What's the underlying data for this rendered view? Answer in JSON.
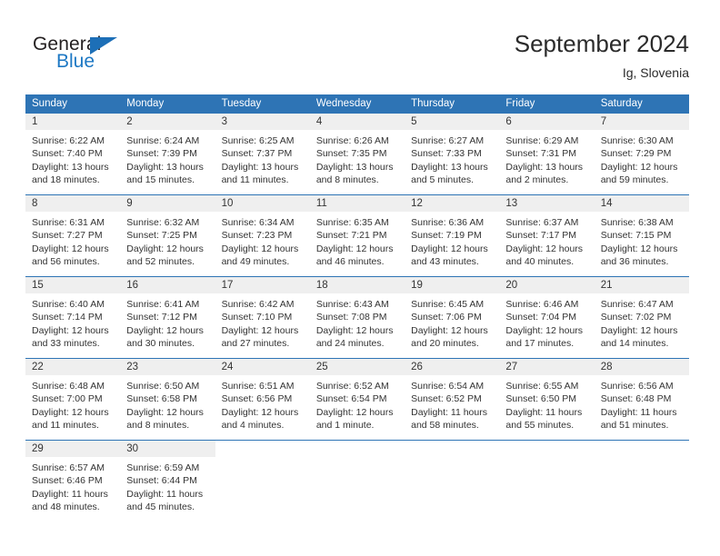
{
  "brand": {
    "name_dark": "General",
    "name_blue": "Blue",
    "triangle_color": "#1d6fb7"
  },
  "header": {
    "title": "September 2024",
    "subtitle": "Ig, Slovenia"
  },
  "theme": {
    "header_blue": "#2e74b5",
    "day_strip_gray": "#efefef",
    "text_color": "#333333"
  },
  "weekdays": [
    "Sunday",
    "Monday",
    "Tuesday",
    "Wednesday",
    "Thursday",
    "Friday",
    "Saturday"
  ],
  "weeks": [
    [
      {
        "day": "1",
        "sunrise": "Sunrise: 6:22 AM",
        "sunset": "Sunset: 7:40 PM",
        "daylight1": "Daylight: 13 hours",
        "daylight2": "and 18 minutes."
      },
      {
        "day": "2",
        "sunrise": "Sunrise: 6:24 AM",
        "sunset": "Sunset: 7:39 PM",
        "daylight1": "Daylight: 13 hours",
        "daylight2": "and 15 minutes."
      },
      {
        "day": "3",
        "sunrise": "Sunrise: 6:25 AM",
        "sunset": "Sunset: 7:37 PM",
        "daylight1": "Daylight: 13 hours",
        "daylight2": "and 11 minutes."
      },
      {
        "day": "4",
        "sunrise": "Sunrise: 6:26 AM",
        "sunset": "Sunset: 7:35 PM",
        "daylight1": "Daylight: 13 hours",
        "daylight2": "and 8 minutes."
      },
      {
        "day": "5",
        "sunrise": "Sunrise: 6:27 AM",
        "sunset": "Sunset: 7:33 PM",
        "daylight1": "Daylight: 13 hours",
        "daylight2": "and 5 minutes."
      },
      {
        "day": "6",
        "sunrise": "Sunrise: 6:29 AM",
        "sunset": "Sunset: 7:31 PM",
        "daylight1": "Daylight: 13 hours",
        "daylight2": "and 2 minutes."
      },
      {
        "day": "7",
        "sunrise": "Sunrise: 6:30 AM",
        "sunset": "Sunset: 7:29 PM",
        "daylight1": "Daylight: 12 hours",
        "daylight2": "and 59 minutes."
      }
    ],
    [
      {
        "day": "8",
        "sunrise": "Sunrise: 6:31 AM",
        "sunset": "Sunset: 7:27 PM",
        "daylight1": "Daylight: 12 hours",
        "daylight2": "and 56 minutes."
      },
      {
        "day": "9",
        "sunrise": "Sunrise: 6:32 AM",
        "sunset": "Sunset: 7:25 PM",
        "daylight1": "Daylight: 12 hours",
        "daylight2": "and 52 minutes."
      },
      {
        "day": "10",
        "sunrise": "Sunrise: 6:34 AM",
        "sunset": "Sunset: 7:23 PM",
        "daylight1": "Daylight: 12 hours",
        "daylight2": "and 49 minutes."
      },
      {
        "day": "11",
        "sunrise": "Sunrise: 6:35 AM",
        "sunset": "Sunset: 7:21 PM",
        "daylight1": "Daylight: 12 hours",
        "daylight2": "and 46 minutes."
      },
      {
        "day": "12",
        "sunrise": "Sunrise: 6:36 AM",
        "sunset": "Sunset: 7:19 PM",
        "daylight1": "Daylight: 12 hours",
        "daylight2": "and 43 minutes."
      },
      {
        "day": "13",
        "sunrise": "Sunrise: 6:37 AM",
        "sunset": "Sunset: 7:17 PM",
        "daylight1": "Daylight: 12 hours",
        "daylight2": "and 40 minutes."
      },
      {
        "day": "14",
        "sunrise": "Sunrise: 6:38 AM",
        "sunset": "Sunset: 7:15 PM",
        "daylight1": "Daylight: 12 hours",
        "daylight2": "and 36 minutes."
      }
    ],
    [
      {
        "day": "15",
        "sunrise": "Sunrise: 6:40 AM",
        "sunset": "Sunset: 7:14 PM",
        "daylight1": "Daylight: 12 hours",
        "daylight2": "and 33 minutes."
      },
      {
        "day": "16",
        "sunrise": "Sunrise: 6:41 AM",
        "sunset": "Sunset: 7:12 PM",
        "daylight1": "Daylight: 12 hours",
        "daylight2": "and 30 minutes."
      },
      {
        "day": "17",
        "sunrise": "Sunrise: 6:42 AM",
        "sunset": "Sunset: 7:10 PM",
        "daylight1": "Daylight: 12 hours",
        "daylight2": "and 27 minutes."
      },
      {
        "day": "18",
        "sunrise": "Sunrise: 6:43 AM",
        "sunset": "Sunset: 7:08 PM",
        "daylight1": "Daylight: 12 hours",
        "daylight2": "and 24 minutes."
      },
      {
        "day": "19",
        "sunrise": "Sunrise: 6:45 AM",
        "sunset": "Sunset: 7:06 PM",
        "daylight1": "Daylight: 12 hours",
        "daylight2": "and 20 minutes."
      },
      {
        "day": "20",
        "sunrise": "Sunrise: 6:46 AM",
        "sunset": "Sunset: 7:04 PM",
        "daylight1": "Daylight: 12 hours",
        "daylight2": "and 17 minutes."
      },
      {
        "day": "21",
        "sunrise": "Sunrise: 6:47 AM",
        "sunset": "Sunset: 7:02 PM",
        "daylight1": "Daylight: 12 hours",
        "daylight2": "and 14 minutes."
      }
    ],
    [
      {
        "day": "22",
        "sunrise": "Sunrise: 6:48 AM",
        "sunset": "Sunset: 7:00 PM",
        "daylight1": "Daylight: 12 hours",
        "daylight2": "and 11 minutes."
      },
      {
        "day": "23",
        "sunrise": "Sunrise: 6:50 AM",
        "sunset": "Sunset: 6:58 PM",
        "daylight1": "Daylight: 12 hours",
        "daylight2": "and 8 minutes."
      },
      {
        "day": "24",
        "sunrise": "Sunrise: 6:51 AM",
        "sunset": "Sunset: 6:56 PM",
        "daylight1": "Daylight: 12 hours",
        "daylight2": "and 4 minutes."
      },
      {
        "day": "25",
        "sunrise": "Sunrise: 6:52 AM",
        "sunset": "Sunset: 6:54 PM",
        "daylight1": "Daylight: 12 hours",
        "daylight2": "and 1 minute."
      },
      {
        "day": "26",
        "sunrise": "Sunrise: 6:54 AM",
        "sunset": "Sunset: 6:52 PM",
        "daylight1": "Daylight: 11 hours",
        "daylight2": "and 58 minutes."
      },
      {
        "day": "27",
        "sunrise": "Sunrise: 6:55 AM",
        "sunset": "Sunset: 6:50 PM",
        "daylight1": "Daylight: 11 hours",
        "daylight2": "and 55 minutes."
      },
      {
        "day": "28",
        "sunrise": "Sunrise: 6:56 AM",
        "sunset": "Sunset: 6:48 PM",
        "daylight1": "Daylight: 11 hours",
        "daylight2": "and 51 minutes."
      }
    ],
    [
      {
        "day": "29",
        "sunrise": "Sunrise: 6:57 AM",
        "sunset": "Sunset: 6:46 PM",
        "daylight1": "Daylight: 11 hours",
        "daylight2": "and 48 minutes."
      },
      {
        "day": "30",
        "sunrise": "Sunrise: 6:59 AM",
        "sunset": "Sunset: 6:44 PM",
        "daylight1": "Daylight: 11 hours",
        "daylight2": "and 45 minutes."
      },
      {
        "day": "",
        "sunrise": "",
        "sunset": "",
        "daylight1": "",
        "daylight2": ""
      },
      {
        "day": "",
        "sunrise": "",
        "sunset": "",
        "daylight1": "",
        "daylight2": ""
      },
      {
        "day": "",
        "sunrise": "",
        "sunset": "",
        "daylight1": "",
        "daylight2": ""
      },
      {
        "day": "",
        "sunrise": "",
        "sunset": "",
        "daylight1": "",
        "daylight2": ""
      },
      {
        "day": "",
        "sunrise": "",
        "sunset": "",
        "daylight1": "",
        "daylight2": ""
      }
    ]
  ]
}
